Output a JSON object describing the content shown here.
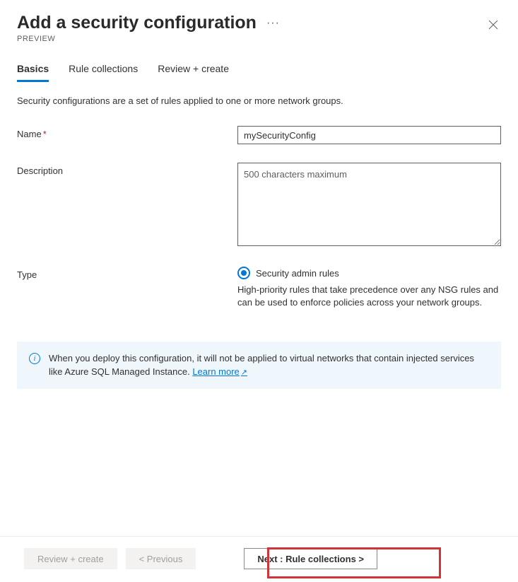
{
  "header": {
    "title": "Add a security configuration",
    "preview": "PREVIEW"
  },
  "tabs": {
    "items": [
      {
        "label": "Basics",
        "active": true
      },
      {
        "label": "Rule collections",
        "active": false
      },
      {
        "label": "Review + create",
        "active": false
      }
    ]
  },
  "description": "Security configurations are a set of rules applied to one or more network groups.",
  "form": {
    "name": {
      "label": "Name",
      "value": "mySecurityConfig",
      "required": true
    },
    "description_field": {
      "label": "Description",
      "placeholder": "500 characters maximum"
    },
    "type": {
      "label": "Type",
      "option_label": "Security admin rules",
      "help_text": "High-priority rules that take precedence over any NSG rules and can be used to enforce policies across your network groups."
    }
  },
  "info": {
    "text_before_link": "When you deploy this configuration, it will not be applied to virtual networks that contain injected services like Azure SQL Managed Instance. ",
    "link_text": "Learn more"
  },
  "footer": {
    "review_create": "Review + create",
    "previous": "< Previous",
    "next": "Next : Rule collections >"
  }
}
